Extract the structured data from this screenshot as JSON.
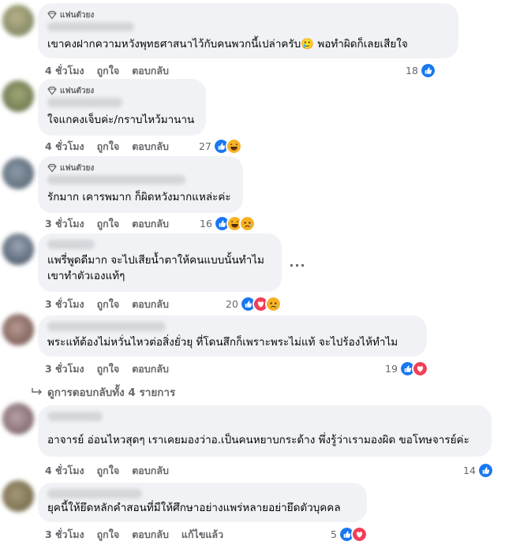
{
  "common": {
    "like": "ถูกใจ",
    "reply": "ตอบกลับ",
    "fan_badge": "แฟนตัวยง"
  },
  "comments": [
    {
      "text": "เขาคงฝากความหวังพุทธศาสนาไว้กับคนพวกนี้เปล่าครับ🥲 พอทำผิดก็เลยเสียใจ",
      "time": "4 ชั่วโมง",
      "count": "18",
      "reactions": [
        "like"
      ]
    },
    {
      "text": "ใจแกคงเจ็บค่ะ/กราบไหว้มานาน",
      "time": "4 ชั่วโมง",
      "count": "27",
      "reactions": [
        "like",
        "haha"
      ]
    },
    {
      "text": "รักมาก เคารพมาก ก็ผิดหวังมากแหล่ะค่ะ",
      "time": "3 ชั่วโมง",
      "count": "16",
      "reactions": [
        "like",
        "haha",
        "sad"
      ]
    },
    {
      "text_line1": "แพรี่พูดดีมาก จะไปเสียน้ำตาให้คนแบบนั้นทำไม",
      "text_line2": "เขาทำตัวเองแท้ๆ",
      "time": "3 ชั่วโมง",
      "count": "20",
      "reactions": [
        "like",
        "love",
        "sad"
      ],
      "more": "···"
    },
    {
      "text": "พระแท้ต้องไม่หวั่นไหวต่อสิ่งยั่วยุ ที่โดนสึกก็เพราะพระไม่แท้ จะไปร้องไห้ทำไม",
      "time": "3 ชั่วโมง",
      "count": "19",
      "reactions": [
        "like",
        "love"
      ]
    },
    {
      "text": "อาจารย์ อ่อนไหวสุดๆ เราเคยมองว่าอ.เป็นคนหยาบกระด้าง พึ่งรู้ว่าเรามองผิด ขอโทษจารย์ค่ะ",
      "time": "4 ชั่วโมง",
      "count": "14",
      "reactions": [
        "like"
      ]
    },
    {
      "text": "ยุคนี้ให้ยึดหลักคำสอนที่มีให้ศึกษาอย่างแพร่หลายอย่ายึดตัวบุคคล",
      "time": "3 ชั่วโมง",
      "edit": "แก้ไขแล้ว",
      "count": "5",
      "reactions": [
        "like",
        "love"
      ]
    }
  ],
  "view_replies": "ดูการตอบกลับทั้ง 4 รายการ",
  "colors": {
    "bubble": "#f0f2f5",
    "meta": "#65676b",
    "like": "#1877f2",
    "love": "#f33e58",
    "haha": "#f7b125"
  }
}
